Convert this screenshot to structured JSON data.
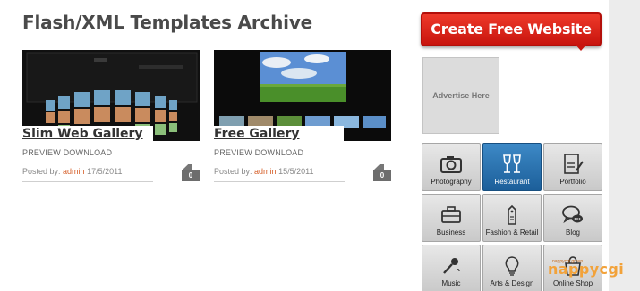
{
  "page": {
    "title": "Flash/XML Templates Archive"
  },
  "posts": [
    {
      "title": "Slim Web Gallery",
      "links": "PREVIEW DOWNLOAD",
      "posted_by_label": "Posted by:",
      "author": "admin",
      "date": "17/5/2011",
      "comments": "0"
    },
    {
      "title": "Free Gallery",
      "links": "PREVIEW DOWNLOAD",
      "posted_by_label": "Posted by:",
      "author": "admin",
      "date": "15/5/2011",
      "comments": "0"
    }
  ],
  "sidebar": {
    "cta_label": "Create Free Website",
    "ad_label": "Advertise Here",
    "categories": [
      {
        "label": "Photography",
        "icon": "camera-icon",
        "active": false
      },
      {
        "label": "Restaurant",
        "icon": "wine-glasses-icon",
        "active": true
      },
      {
        "label": "Portfolio",
        "icon": "cv-document-icon",
        "active": false
      },
      {
        "label": "Business",
        "icon": "briefcase-icon",
        "active": false
      },
      {
        "label": "Fashion & Retail",
        "icon": "price-tag-icon",
        "active": false
      },
      {
        "label": "Blog",
        "icon": "speech-bubbles-icon",
        "active": false
      },
      {
        "label": "Music",
        "icon": "microphone-icon",
        "active": false
      },
      {
        "label": "Arts & Design",
        "icon": "lightbulb-icon",
        "active": false
      },
      {
        "label": "Online Shop",
        "icon": "shopping-bag-icon",
        "active": false
      }
    ]
  },
  "watermark": {
    "text": "nappycgi",
    "tag": "nappycgi group"
  },
  "colors": {
    "title": "#4a4a4a",
    "author_link": "#d6602a",
    "cta": "#e0241a",
    "active_category": "#2a73b4"
  }
}
